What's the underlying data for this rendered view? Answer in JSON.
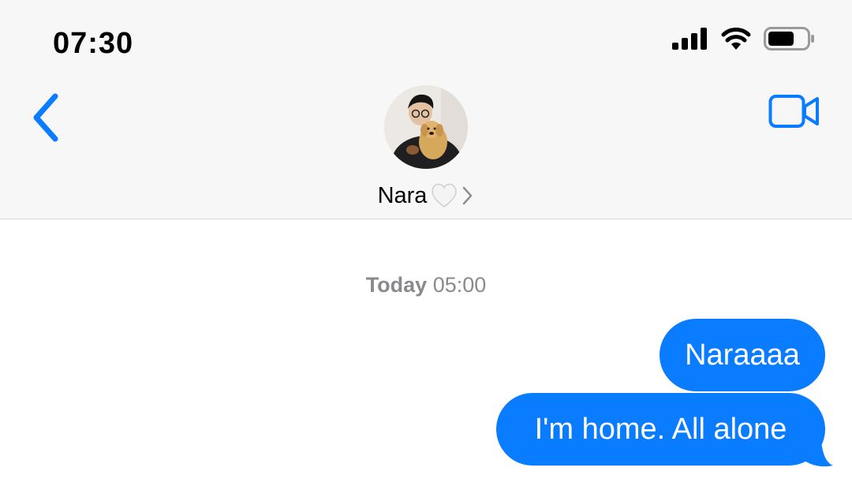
{
  "status_bar": {
    "time": "07:30",
    "icons": [
      "cellular-signal-icon",
      "wifi-icon",
      "battery-icon"
    ]
  },
  "nav": {
    "back_icon": "chevron-left-icon",
    "video_icon": "video-camera-icon",
    "contact": {
      "name": "Nara",
      "name_emoji": "white-heart",
      "disclosure_icon": "chevron-right-icon"
    }
  },
  "conversation": {
    "timestamp_day": "Today",
    "timestamp_time": "05:00",
    "messages": [
      {
        "direction": "sent",
        "text": "Naraaaa"
      },
      {
        "direction": "sent",
        "text": "I'm home. All alone"
      }
    ]
  },
  "colors": {
    "accent": "#0a7cff",
    "header_bg": "#f7f7f7",
    "timestamp": "#8a8a8e"
  }
}
